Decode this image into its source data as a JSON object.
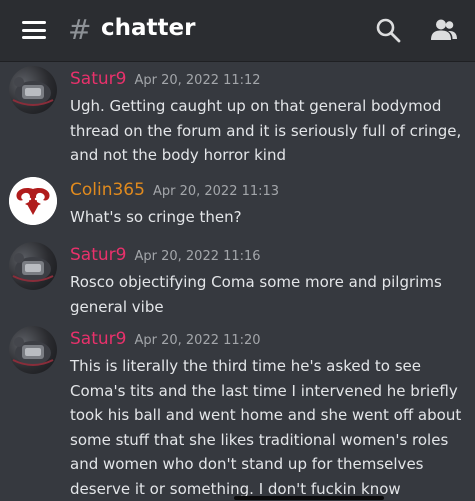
{
  "header": {
    "channel_hash": "#",
    "channel_name": "chatter",
    "menu_icon": "hamburger-menu-icon",
    "search_icon": "search-icon",
    "members_icon": "members-icon"
  },
  "messages": [
    {
      "author": "Satur9",
      "timestamp": "Apr 20, 2022 11:12",
      "text": "Ugh. Getting caught up on that general bodymod thread on the forum and it is seriously full of cringe, and not the body horror kind",
      "name_color": "#e8316b"
    },
    {
      "author": "Colin365",
      "timestamp": "Apr 20, 2022 11:13",
      "text": "What's so cringe then?",
      "name_color": "#e08a1e"
    },
    {
      "author": "Satur9",
      "timestamp": "Apr 20, 2022 11:16",
      "text": "Rosco objectifying Coma some more and pilgrims general vibe",
      "name_color": "#e8316b"
    },
    {
      "author": "Satur9",
      "timestamp": "Apr 20, 2022 11:20",
      "text": "This is literally the third time he's asked to see Coma's tits and the last time I intervened he briefly took his ball and went home and she went off about some stuff that she likes traditional women's roles and women who don't stand up for themselves deserve it or something. I don't fuckin know",
      "name_color": "#e8316b"
    }
  ]
}
